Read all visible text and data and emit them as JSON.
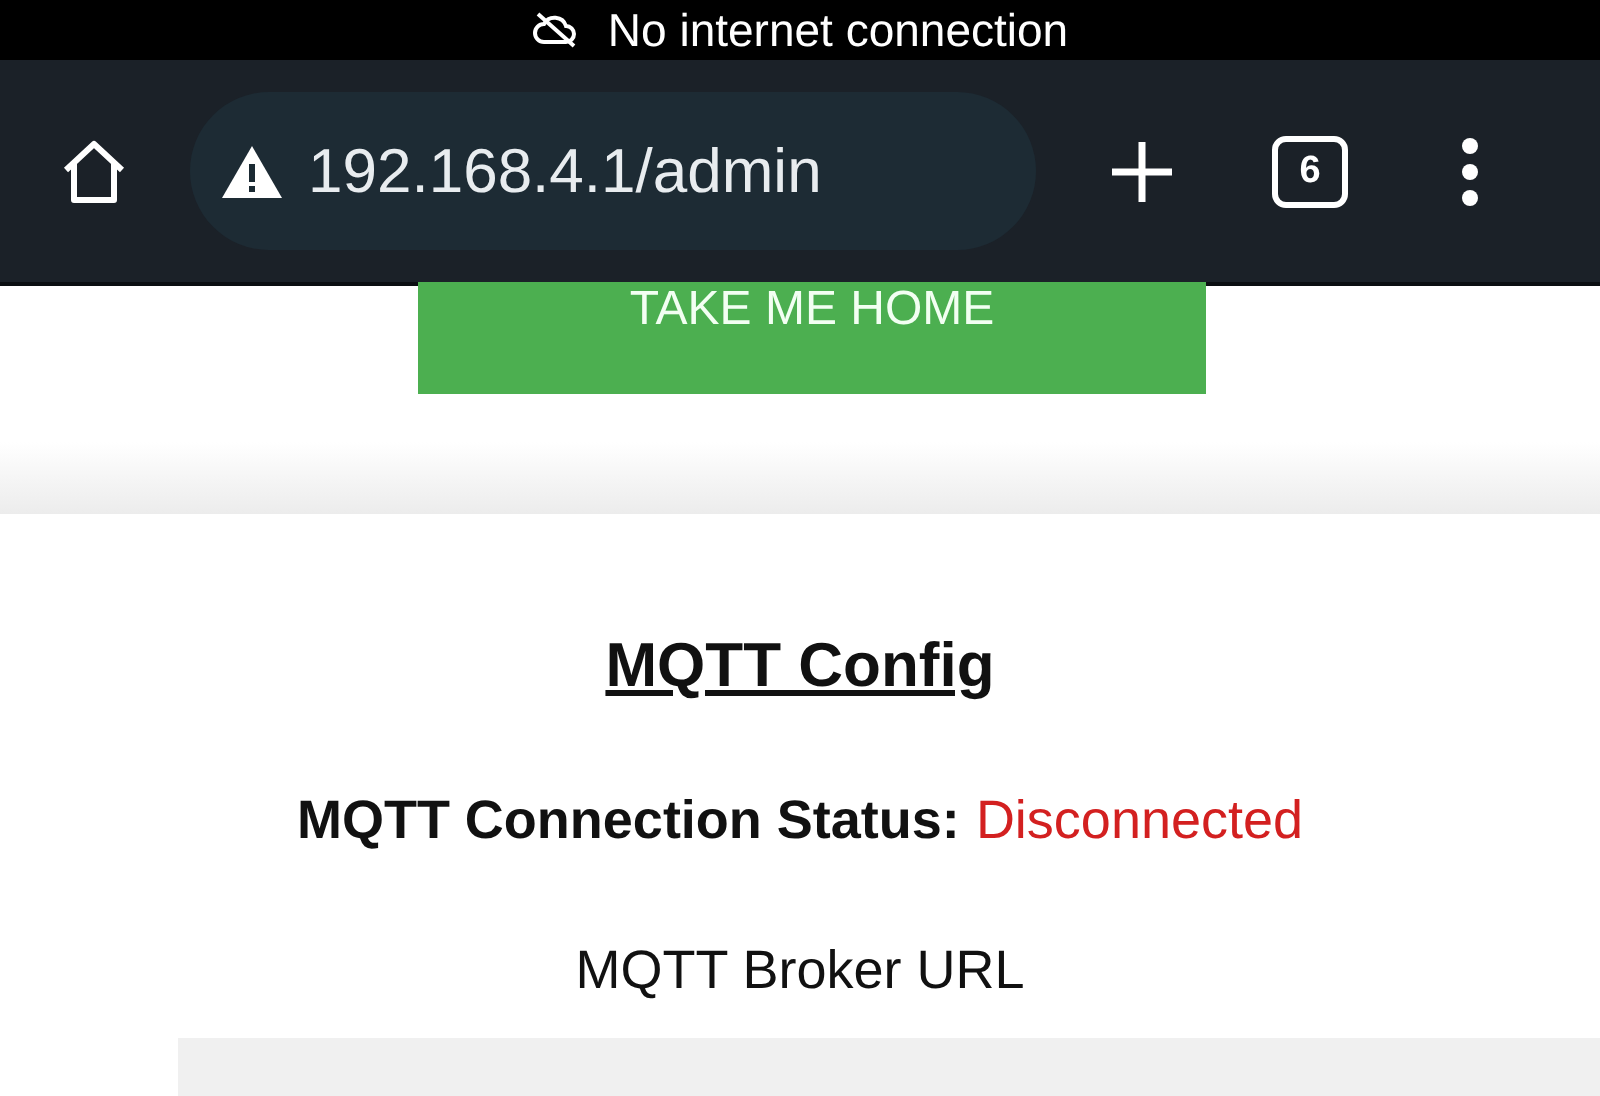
{
  "status_bar": {
    "text": "No internet connection"
  },
  "browser": {
    "url": "192.168.4.1/admin",
    "tab_count": "6"
  },
  "page": {
    "home_button": "TAKE ME HOME",
    "title": "MQTT Config",
    "status_label": "MQTT Connection Status:",
    "status_value": "Disconnected",
    "connected": false,
    "broker_label": "MQTT Broker URL"
  }
}
